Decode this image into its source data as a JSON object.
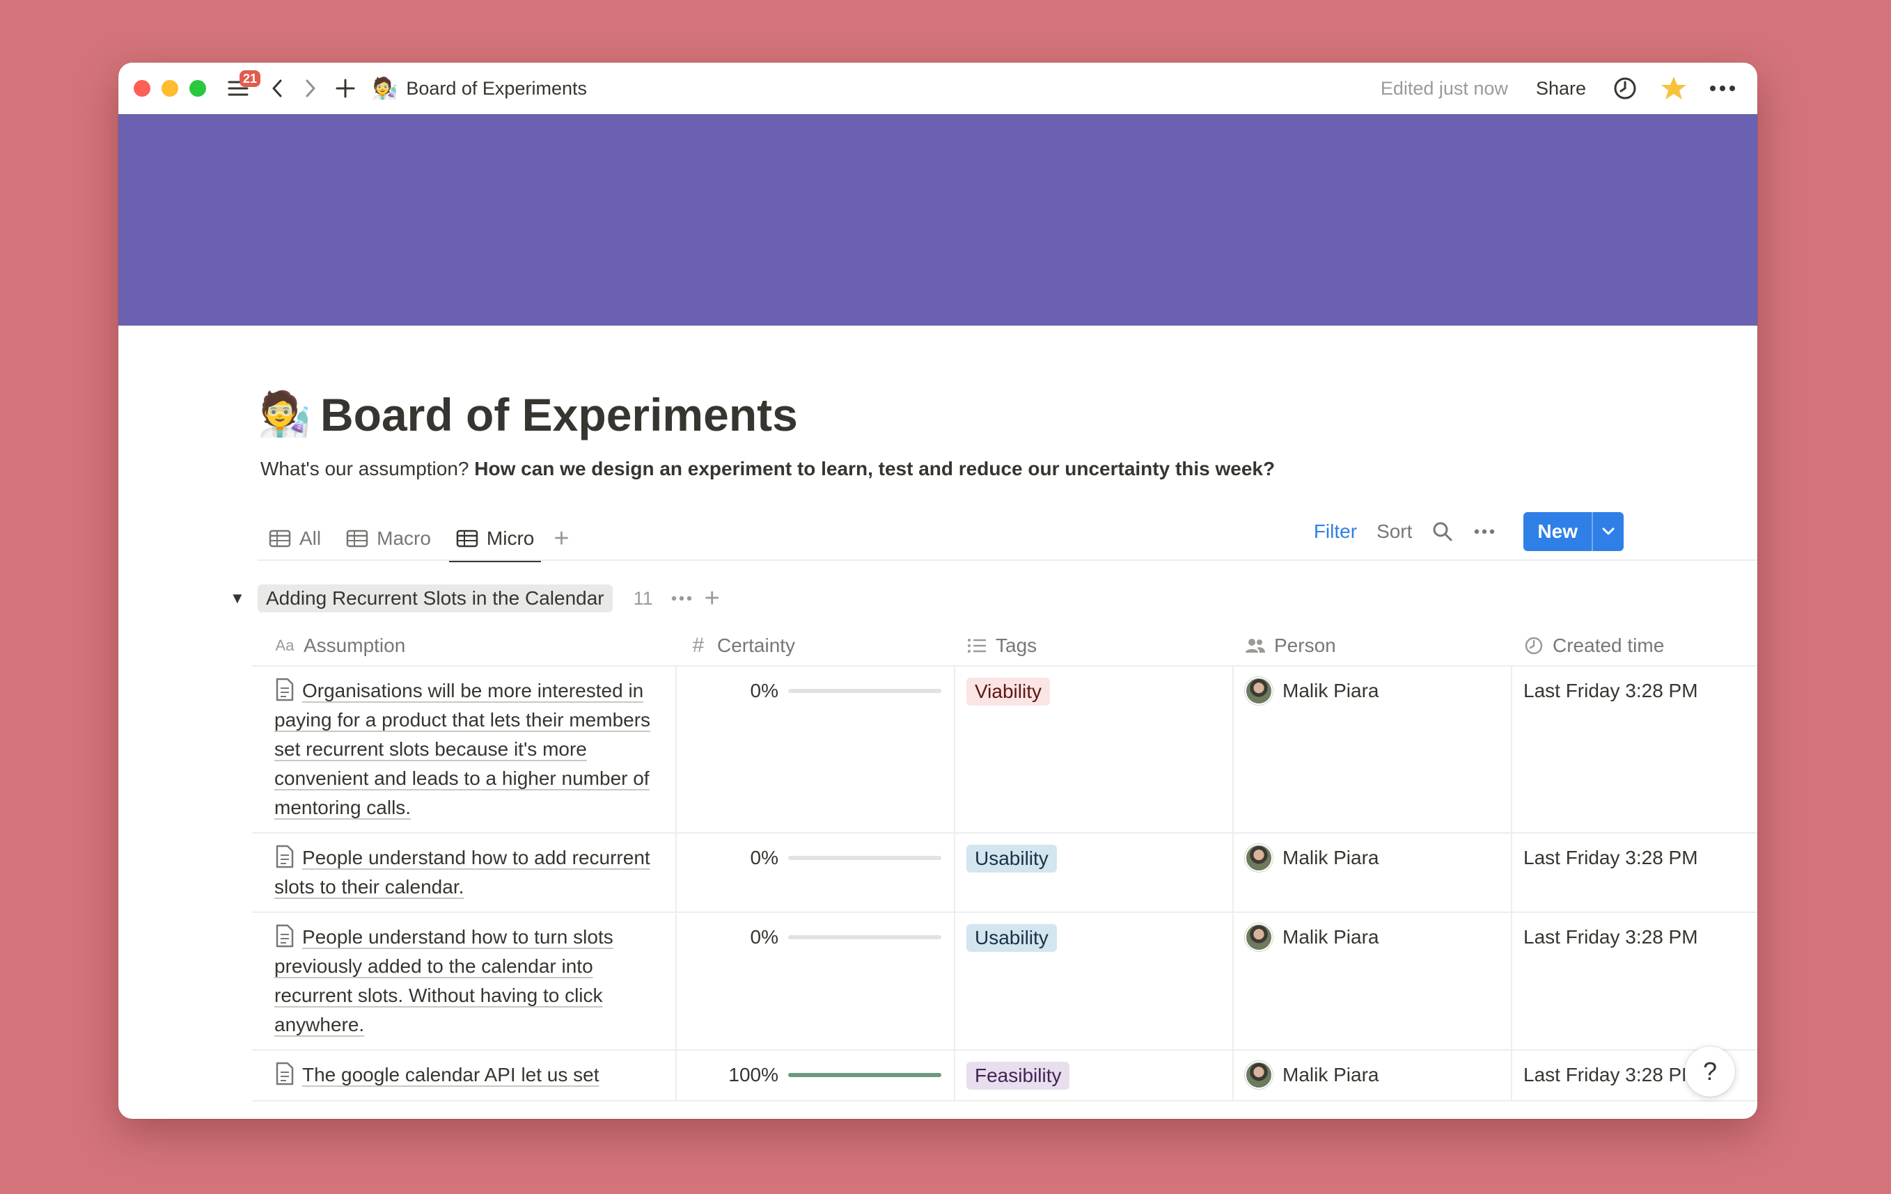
{
  "titlebar": {
    "badge_count": "21",
    "page_emoji": "🧑‍🔬",
    "page_title": "Board of Experiments",
    "edited": "Edited just now",
    "share": "Share"
  },
  "colors": {
    "cover": "#6a61b0",
    "accent": "#2f80e6",
    "background": "#d4747a"
  },
  "page": {
    "emoji": "🧑‍🔬",
    "title": "Board of Experiments",
    "desc_plain": "What's our assumption? ",
    "desc_bold": "How can we design an experiment to learn, test and reduce our uncertainty this week?"
  },
  "tabs": [
    {
      "label": "All",
      "icon": "table-icon",
      "active": false
    },
    {
      "label": "Macro",
      "icon": "table-icon",
      "active": false
    },
    {
      "label": "Micro",
      "icon": "table-icon",
      "active": true
    }
  ],
  "toolbar": {
    "filter": "Filter",
    "sort": "Sort",
    "new": "New"
  },
  "group": {
    "label": "Adding Recurrent Slots in the Calendar",
    "count": "11"
  },
  "columns": [
    {
      "label": "Assumption",
      "icon": "Aa"
    },
    {
      "label": "Certainty",
      "icon": "#"
    },
    {
      "label": "Tags",
      "icon": "list-icon"
    },
    {
      "label": "Person",
      "icon": "people-icon"
    },
    {
      "label": "Created time",
      "icon": "clock-icon"
    }
  ],
  "rows": [
    {
      "assumption": "Organisations will be more interested in paying for a product that lets their members set recurrent slots because it's more convenient and leads to a higher number of mentoring calls.",
      "certainty": "0%",
      "certainty_value": 0,
      "tag": "Viability",
      "person": "Malik Piara",
      "created": "Last Friday 3:28 PM"
    },
    {
      "assumption": "People understand how to add recurrent slots to their calendar.",
      "certainty": "0%",
      "certainty_value": 0,
      "tag": "Usability",
      "person": "Malik Piara",
      "created": "Last Friday 3:28 PM"
    },
    {
      "assumption": "People understand how to turn slots previously added to the calendar into recurrent slots. Without having to click anywhere.",
      "certainty": "0%",
      "certainty_value": 0,
      "tag": "Usability",
      "person": "Malik Piara",
      "created": "Last Friday 3:28 PM"
    },
    {
      "assumption": "The google calendar API let us set",
      "certainty": "100%",
      "certainty_value": 1,
      "tag": "Feasibility",
      "person": "Malik Piara",
      "created": "Last Friday 3:28 PM"
    }
  ],
  "tag_colors": {
    "Viability": {
      "bg": "#fbe4e4",
      "fg": "#5d1715"
    },
    "Usability": {
      "bg": "#d3e5ef",
      "fg": "#183347"
    },
    "Feasibility": {
      "bg": "#e8deee",
      "fg": "#412454"
    }
  },
  "help": "?"
}
